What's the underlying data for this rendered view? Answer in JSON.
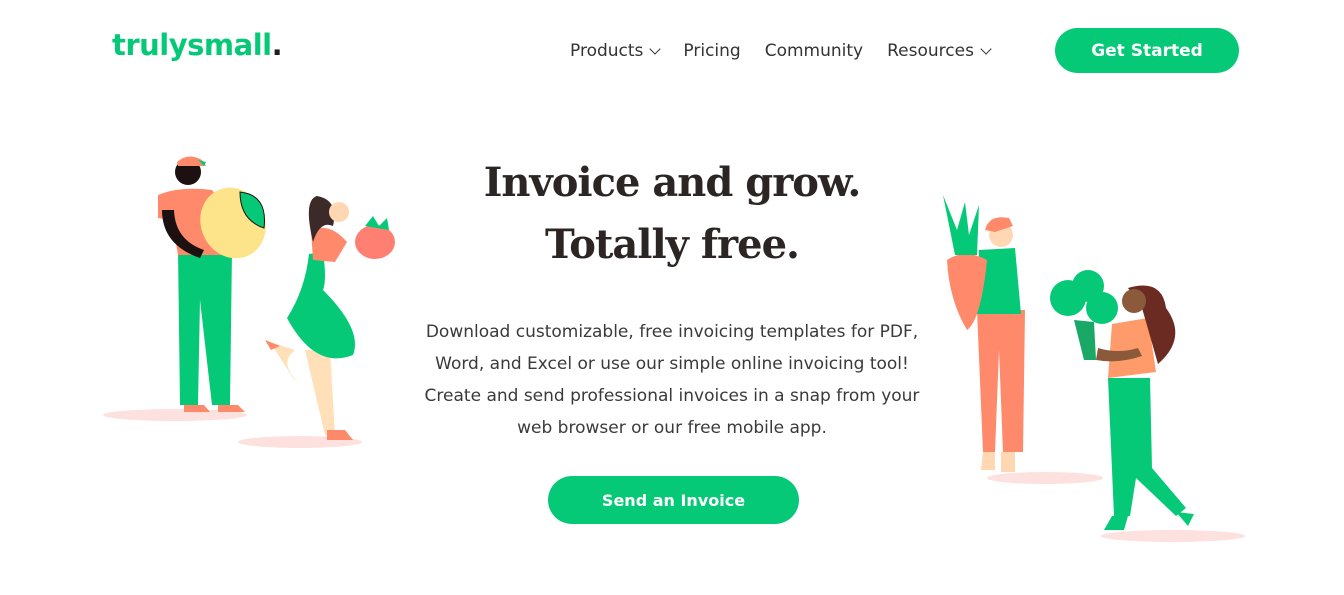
{
  "header": {
    "logo_text": "trulysmall",
    "logo_dot": ".",
    "nav": [
      {
        "label": "Products",
        "has_dropdown": true
      },
      {
        "label": "Pricing",
        "has_dropdown": false
      },
      {
        "label": "Community",
        "has_dropdown": false
      },
      {
        "label": "Resources",
        "has_dropdown": true
      }
    ],
    "cta_label": "Get Started"
  },
  "hero": {
    "title_line1": "Invoice and grow.",
    "title_line2": "Totally free.",
    "description": "Download customizable, free invoicing templates for PDF, Word, and Excel or use our simple online invoicing tool! Create and send professional invoices in a snap from your web browser or our free mobile app.",
    "cta_label": "Send an Invoice"
  },
  "colors": {
    "brand_green": "#06c977",
    "text_dark": "#2b2523",
    "coral": "#ff8a6b",
    "skin_light": "#ffd7b3",
    "shadow_pink": "#fde1df"
  },
  "illustrations": {
    "left": [
      "man-with-lemon",
      "woman-with-strawberry"
    ],
    "right": [
      "woman-with-carrot",
      "woman-with-broccoli"
    ]
  }
}
